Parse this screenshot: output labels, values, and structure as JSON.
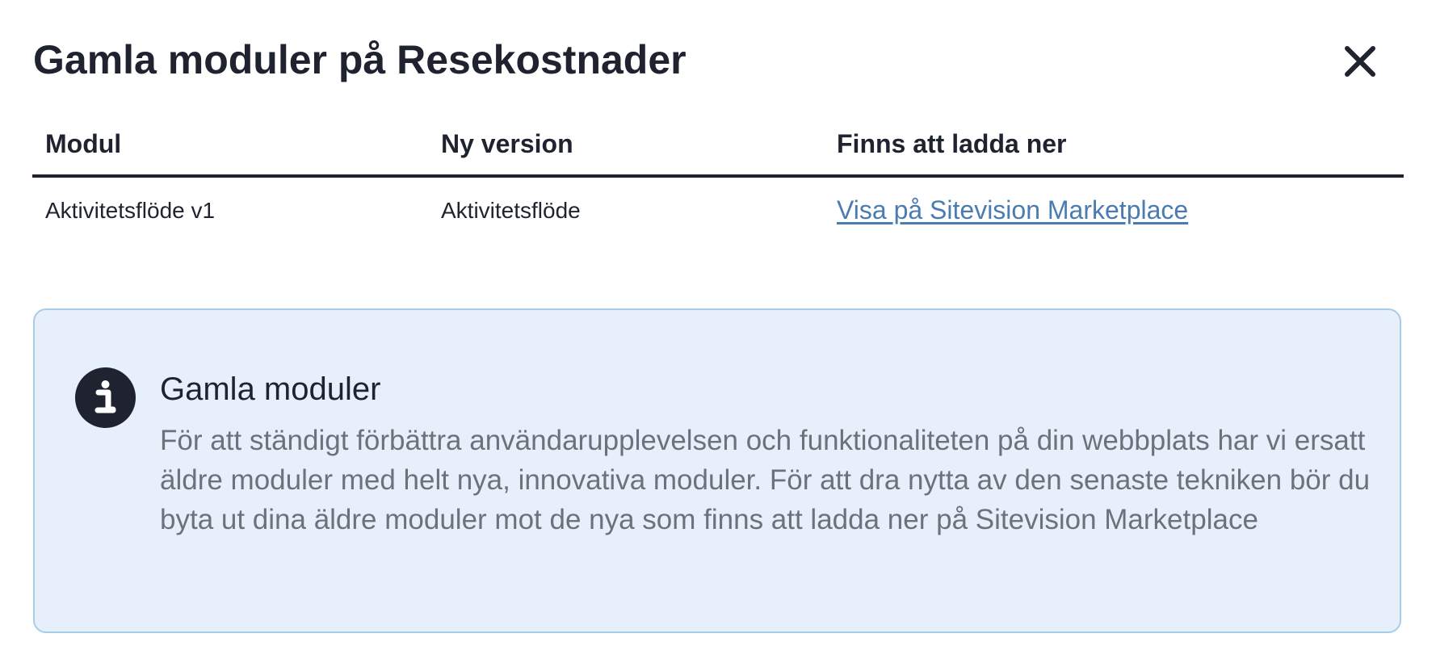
{
  "dialog": {
    "title": "Gamla moduler på Resekostnader",
    "close_icon": "close-icon"
  },
  "table": {
    "headers": [
      "Modul",
      "Ny version",
      "Finns att ladda ner"
    ],
    "rows": [
      {
        "modul": "Aktivitetsflöde v1",
        "ny_version": "Aktivitetsflöde",
        "link_text": "Visa på Sitevision Marketplace"
      }
    ]
  },
  "info": {
    "icon": "info-icon",
    "title": "Gamla moduler",
    "text": "För att ständigt förbättra användarupplevelsen och funktionaliteten på din webbplats har vi ersatt äldre moduler med helt nya, innovativa moduler. För att dra nytta av den senaste tekniken bör du byta ut dina äldre moduler mot de nya som finns att ladda ner på Sitevision Marketplace"
  },
  "colors": {
    "text": "#1f2330",
    "link": "#4a7bb1",
    "info_background": "#e7f0fa",
    "info_border": "#a7cdeb",
    "info_text": "#6c717c"
  }
}
